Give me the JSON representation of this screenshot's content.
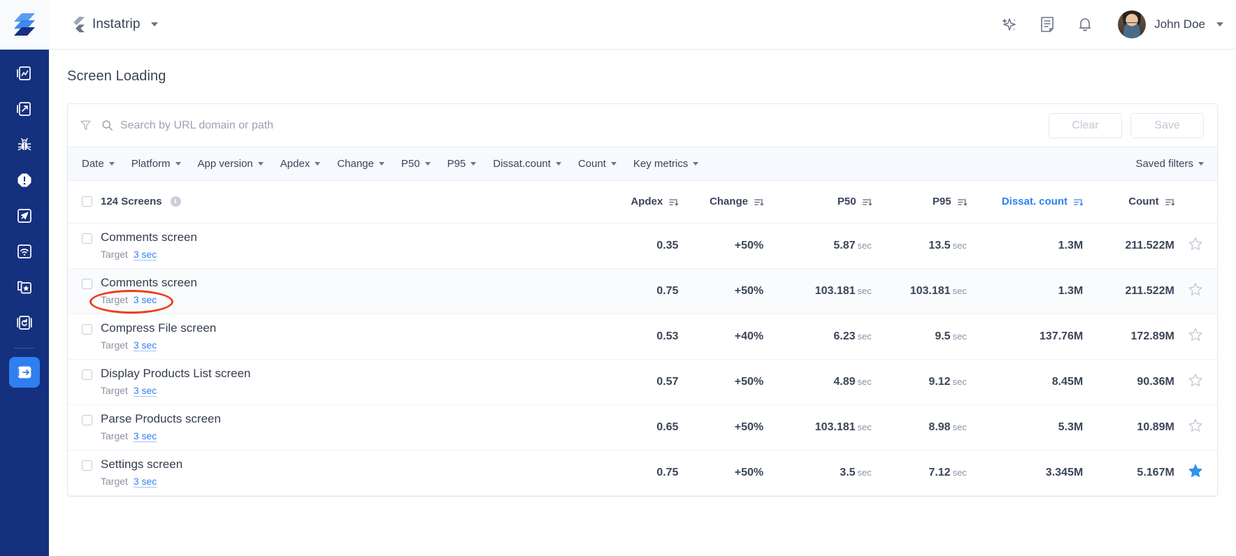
{
  "topbar": {
    "logo_icon": "layers-logo",
    "app_icon": "flutter-icon",
    "app_name": "Instatrip",
    "app_switcher_caret": "chevron-down-icon",
    "actions": [
      {
        "icon": "sparkle-ai-icon",
        "name": "ai-assistant-button"
      },
      {
        "icon": "document-icon",
        "name": "docs-button"
      },
      {
        "icon": "bell-icon",
        "name": "notifications-button"
      }
    ],
    "user_name": "John Doe",
    "user_caret": "chevron-down-icon"
  },
  "sidebar": {
    "items": [
      {
        "icon": "dashboard-chart-icon",
        "name": "sidebar-item-dashboard",
        "active": false
      },
      {
        "icon": "report-page-icon",
        "name": "sidebar-item-reports",
        "active": false
      },
      {
        "icon": "bug-icon",
        "name": "sidebar-item-bugs",
        "active": false
      },
      {
        "icon": "alert-exclamation-icon",
        "name": "sidebar-item-errors",
        "active": false
      },
      {
        "icon": "rocket-launch-icon",
        "name": "sidebar-item-launch",
        "active": false
      },
      {
        "icon": "wifi-signal-icon",
        "name": "sidebar-item-network",
        "active": false
      },
      {
        "icon": "star-layers-icon",
        "name": "sidebar-item-favorites",
        "active": false
      },
      {
        "icon": "history-restore-icon",
        "name": "sidebar-item-history",
        "active": false
      }
    ],
    "active_item": {
      "icon": "screen-loading-icon",
      "name": "sidebar-item-screen-loading",
      "active": true
    }
  },
  "page": {
    "title": "Screen Loading"
  },
  "search": {
    "filter_icon": "funnel-icon",
    "search_icon": "search-icon",
    "placeholder": "Search by URL domain or path",
    "value": "",
    "clear_label": "Clear",
    "save_label": "Save"
  },
  "filters": {
    "chips": [
      {
        "label": "Date",
        "name": "filter-date"
      },
      {
        "label": "Platform",
        "name": "filter-platform"
      },
      {
        "label": "App version",
        "name": "filter-app-version"
      },
      {
        "label": "Apdex",
        "name": "filter-apdex"
      },
      {
        "label": "Change",
        "name": "filter-change"
      },
      {
        "label": "P50",
        "name": "filter-p50"
      },
      {
        "label": "P95",
        "name": "filter-p95"
      },
      {
        "label": "Dissat.count",
        "name": "filter-dissat-count"
      },
      {
        "label": "Count",
        "name": "filter-count"
      },
      {
        "label": "Key metrics",
        "name": "filter-key-metrics"
      }
    ],
    "saved_filters_label": "Saved filters"
  },
  "table": {
    "select_all_checked": false,
    "count_label": "124 Screens",
    "info_icon": "info-icon",
    "columns": [
      {
        "label": "Apdex",
        "sorted": false,
        "sort_icon": "sort-desc-icon"
      },
      {
        "label": "Change",
        "sorted": false,
        "sort_icon": "sort-desc-icon"
      },
      {
        "label": "P50",
        "sorted": false,
        "sort_icon": "sort-desc-icon"
      },
      {
        "label": "P95",
        "sorted": false,
        "sort_icon": "sort-desc-icon"
      },
      {
        "label": "Dissat. count",
        "sorted": true,
        "sort_icon": "sort-desc-icon"
      },
      {
        "label": "Count",
        "sorted": false,
        "sort_icon": "sort-desc-icon"
      }
    ],
    "target_label": "Target",
    "unit_sec": "sec",
    "rows": [
      {
        "name": "Comments screen",
        "target": "3 sec",
        "target_linked": true,
        "apdex": "0.35",
        "apdex_color": "red",
        "change": "+50%",
        "p50": "5.87",
        "p95": "13.5",
        "dissat_count": "1.3M",
        "count": "211.522M",
        "starred": false,
        "annotated": false
      },
      {
        "name": "Comments screen",
        "target": "3 sec",
        "target_linked": false,
        "apdex": "0.75",
        "apdex_color": "amber",
        "change": "+50%",
        "p50": "103.181",
        "p95": "103.181",
        "dissat_count": "1.3M",
        "count": "211.522M",
        "starred": false,
        "annotated": true
      },
      {
        "name": "Compress File screen",
        "target": "3 sec",
        "target_linked": true,
        "apdex": "0.53",
        "apdex_color": "amber",
        "change": "+40%",
        "p50": "6.23",
        "p95": "9.5",
        "dissat_count": "137.76M",
        "count": "172.89M",
        "starred": false,
        "annotated": false
      },
      {
        "name": "Display Products List screen",
        "target": "3 sec",
        "target_linked": true,
        "apdex": "0.57",
        "apdex_color": "amber",
        "change": "+50%",
        "p50": "4.89",
        "p95": "9.12",
        "dissat_count": "8.45M",
        "count": "90.36M",
        "starred": false,
        "annotated": false
      },
      {
        "name": "Parse Products screen",
        "target": "3 sec",
        "target_linked": true,
        "apdex": "0.65",
        "apdex_color": "amber",
        "change": "+50%",
        "p50": "103.181",
        "p95": "8.98",
        "dissat_count": "5.3M",
        "count": "10.89M",
        "starred": false,
        "annotated": false
      },
      {
        "name": "Settings screen",
        "target": "3 sec",
        "target_linked": true,
        "apdex": "0.75",
        "apdex_color": "amber",
        "change": "+50%",
        "p50": "3.5",
        "p95": "7.12",
        "dissat_count": "3.345M",
        "count": "5.167M",
        "starred": true,
        "annotated": false
      }
    ]
  },
  "colors": {
    "sidebar_bg": "#15307e",
    "accent_blue": "#2f7ff0",
    "apdex_red": "#f04e23",
    "apdex_amber": "#f5a623",
    "annotation_red": "#ef3b18",
    "text_primary": "#3b4559",
    "text_muted": "#8a92a2"
  }
}
